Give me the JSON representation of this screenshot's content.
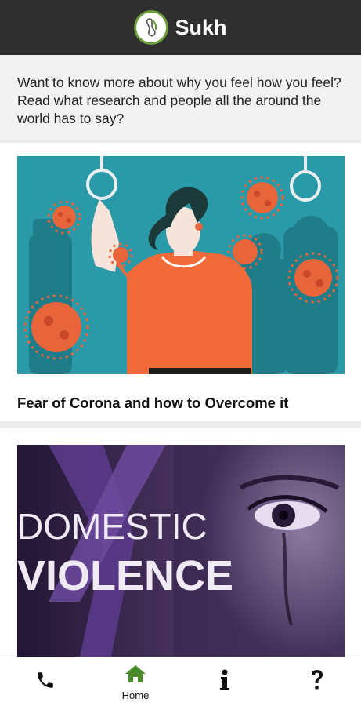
{
  "app": {
    "title": "Sukh"
  },
  "intro": {
    "text": "Want to know more about why you feel how you feel? Read what research and people all the around the world has to say?"
  },
  "articles": [
    {
      "title": "Fear of Corona and how to Overcome it"
    },
    {
      "title": "",
      "image_text_line1": "DOMESTIC",
      "image_text_line2": "VIOLENCE"
    }
  ],
  "nav": [
    {
      "icon": "phone-icon",
      "label": ""
    },
    {
      "icon": "home-icon",
      "label": "Home"
    },
    {
      "icon": "info-icon",
      "label": ""
    },
    {
      "icon": "help-icon",
      "label": ""
    }
  ],
  "colors": {
    "topbar": "#2f2f2f",
    "accent_green": "#4a8c2a",
    "virus": "#e8643a",
    "teal": "#2a9aa8"
  }
}
